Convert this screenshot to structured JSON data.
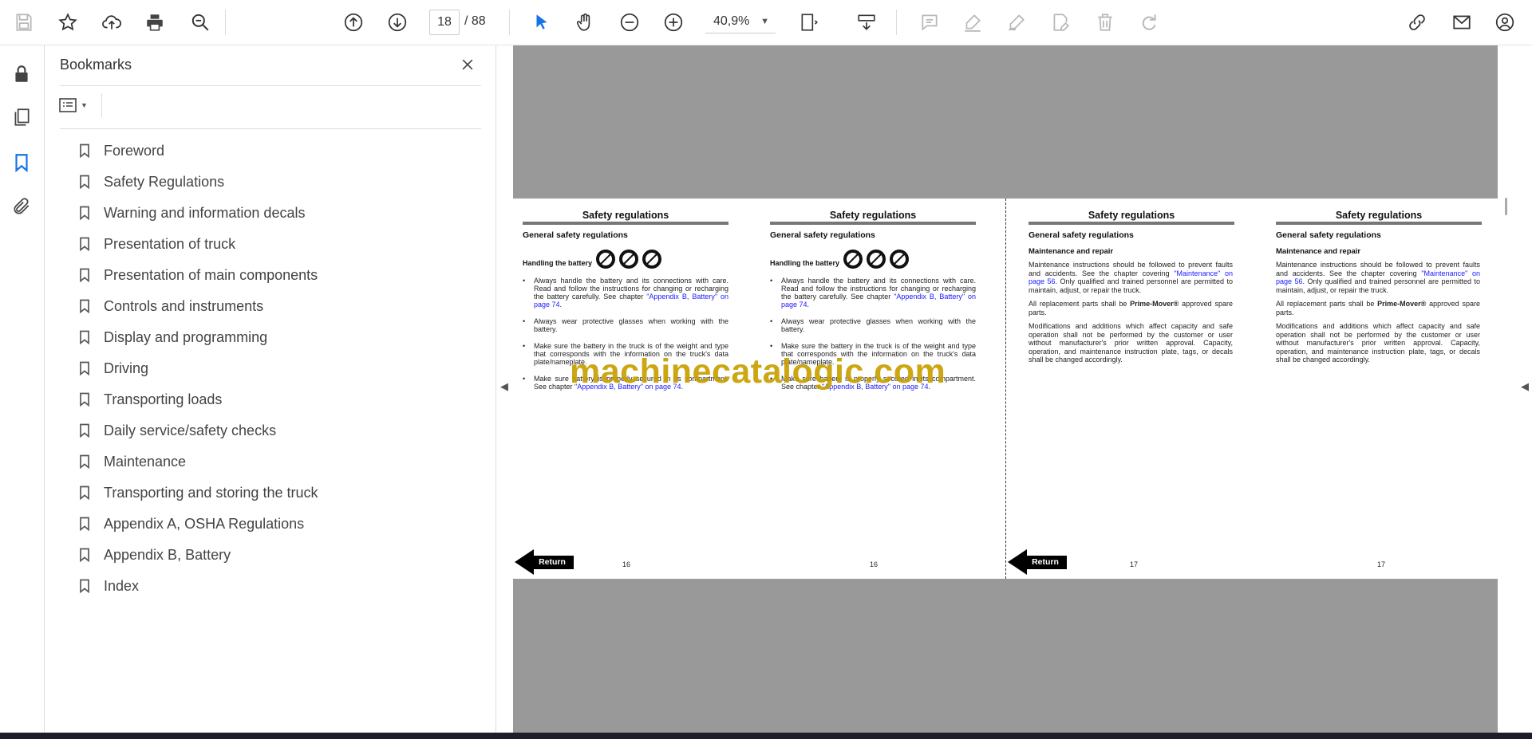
{
  "toolbar": {
    "page_current": "18",
    "page_total": "/ 88",
    "zoom": "40,9%",
    "icons": [
      "save-icon",
      "star-icon",
      "upload-cloud-icon",
      "print-icon",
      "zoom-search-icon",
      "page-up-icon",
      "page-down-icon",
      "select-cursor-icon",
      "hand-icon",
      "zoom-out-icon",
      "zoom-in-icon",
      "page-fit-icon",
      "scroll-mode-icon",
      "comment-icon",
      "highlight-icon",
      "pen-sign-icon",
      "edit-doc-icon",
      "delete-icon",
      "redo-icon",
      "share-link-icon",
      "mail-icon",
      "user-icon"
    ]
  },
  "bookmarks_panel": {
    "title": "Bookmarks",
    "items": [
      {
        "label": "Foreword"
      },
      {
        "label": "Safety Regulations"
      },
      {
        "label": "Warning and information decals"
      },
      {
        "label": "Presentation of truck"
      },
      {
        "label": "Presentation of main components"
      },
      {
        "label": "Controls and instruments"
      },
      {
        "label": "Display and programming"
      },
      {
        "label": "Driving"
      },
      {
        "label": "Transporting loads"
      },
      {
        "label": "Daily service/safety checks"
      },
      {
        "label": "Maintenance"
      },
      {
        "label": "Transporting and storing the truck"
      },
      {
        "label": "Appendix A, OSHA Regulations"
      },
      {
        "label": "Appendix B, Battery"
      },
      {
        "label": "Index"
      }
    ]
  },
  "document": {
    "page16": {
      "header": "Safety regulations",
      "subheader": "General safety regulations",
      "handling": "Handling the battery",
      "b1": "Always handle the battery and its connections with care. Read and follow the instructions for changing or recharging the battery carefully. See chapter ",
      "b1_link": "\"Appendix B, Battery\" on page 74",
      "b2": "Always wear protective glasses when working with the battery.",
      "b3": "Make sure the battery in the truck is of the weight and type that corresponds with the information on the truck's data plate/nameplate.",
      "b4": "Make sure battery is properly secured in its compartment. See chapter ",
      "b4_link": "\"Appendix B, Battery\" on page 74",
      "page_number": "16"
    },
    "page17": {
      "header": "Safety regulations",
      "subheader": "General safety regulations",
      "section": "Maintenance and repair",
      "p1a": "Maintenance instructions should be followed to prevent faults and accidents. See the chapter covering ",
      "p1_link": "\"Maintenance\" on page 56",
      "p1b": ". Only qualified and trained personnel are permitted to maintain, adjust, or repair the truck.",
      "p2a": "All replacement parts shall be ",
      "p2_bold": "Prime-Mover®",
      "p2b": " approved spare parts.",
      "p3": "Modifications and additions which affect capacity and safe operation shall not be performed by the customer or user without manufacturer's prior written approval. Capacity, operation, and maintenance instruction plate, tags, or decals shall be changed accordingly.",
      "page_number": "17"
    },
    "return_label": "Return",
    "watermark": "machinecatalogic.com"
  }
}
